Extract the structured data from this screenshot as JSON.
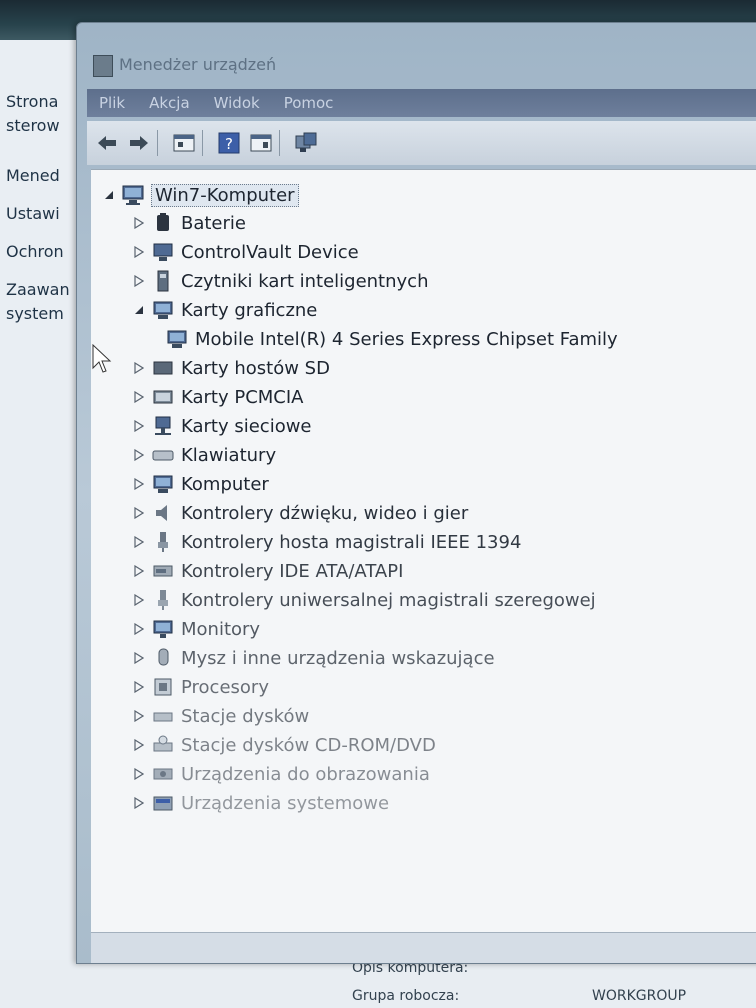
{
  "background": {
    "left_links": [
      "Strona",
      "sterow",
      "Mened",
      "Ustawi",
      "Ochron",
      "Zaawan",
      "system"
    ],
    "footer": {
      "opis_label": "Opis komputera:",
      "grupa_label": "Grupa robocza:",
      "grupa_value": "WORKGROUP"
    }
  },
  "window": {
    "title": "Menedżer urządzeń",
    "menu": [
      "Plik",
      "Akcja",
      "Widok",
      "Pomoc"
    ],
    "toolbar_icons": [
      "back-arrow-icon",
      "forward-arrow-icon",
      "properties-icon",
      "help-icon",
      "console-tree-icon",
      "scan-hardware-icon"
    ]
  },
  "tree": {
    "root": "Win7-Komputer",
    "items": [
      {
        "label": "Baterie",
        "icon": "battery-icon",
        "expanded": false
      },
      {
        "label": "ControlVault Device",
        "icon": "device-icon",
        "expanded": false
      },
      {
        "label": "Czytniki kart inteligentnych",
        "icon": "smartcard-reader-icon",
        "expanded": false
      },
      {
        "label": "Karty graficzne",
        "icon": "display-adapter-icon",
        "expanded": true
      },
      {
        "label": "Mobile Intel(R) 4 Series Express Chipset Family",
        "icon": "display-adapter-icon",
        "child": true
      },
      {
        "label": "Karty hostów SD",
        "icon": "sd-host-icon",
        "expanded": false
      },
      {
        "label": "Karty PCMCIA",
        "icon": "pcmcia-icon",
        "expanded": false
      },
      {
        "label": "Karty sieciowe",
        "icon": "network-adapter-icon",
        "expanded": false
      },
      {
        "label": "Klawiatury",
        "icon": "keyboard-icon",
        "expanded": false
      },
      {
        "label": "Komputer",
        "icon": "computer-icon",
        "expanded": false
      },
      {
        "label": "Kontrolery dźwięku, wideo i gier",
        "icon": "speaker-icon",
        "expanded": false
      },
      {
        "label": "Kontrolery hosta magistrali IEEE 1394",
        "icon": "ieee1394-icon",
        "expanded": false
      },
      {
        "label": "Kontrolery IDE ATA/ATAPI",
        "icon": "ide-controller-icon",
        "expanded": false
      },
      {
        "label": "Kontrolery uniwersalnej magistrali szeregowej",
        "icon": "usb-icon",
        "expanded": false
      },
      {
        "label": "Monitory",
        "icon": "monitor-icon",
        "expanded": false
      },
      {
        "label": "Mysz i inne urządzenia wskazujące",
        "icon": "mouse-icon",
        "expanded": false
      },
      {
        "label": "Procesory",
        "icon": "processor-icon",
        "expanded": false
      },
      {
        "label": "Stacje dysków",
        "icon": "disk-drive-icon",
        "expanded": false
      },
      {
        "label": "Stacje dysków CD-ROM/DVD",
        "icon": "cdrom-icon",
        "expanded": false
      },
      {
        "label": "Urządzenia do obrazowania",
        "icon": "imaging-device-icon",
        "expanded": false
      },
      {
        "label": "Urządzenia systemowe",
        "icon": "system-device-icon",
        "expanded": false
      }
    ]
  }
}
